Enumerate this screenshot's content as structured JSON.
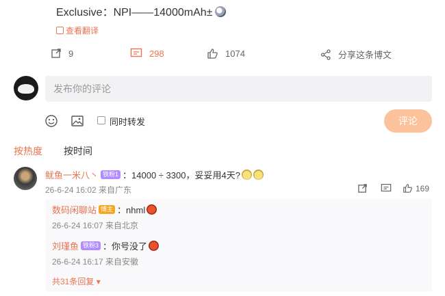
{
  "post": {
    "text": "Exclusive：NPI——14000mAh±",
    "translate_label": "查看翻译",
    "repost_count": "9",
    "comment_count": "298",
    "like_count": "1074",
    "share_label": "分享这条博文"
  },
  "composer": {
    "placeholder": "发布你的评论",
    "repost_label": "同时转发",
    "submit_label": "评论"
  },
  "sort": {
    "hot": "按热度",
    "time": "按时间"
  },
  "comment": {
    "user": "鱿鱼一米八丶",
    "badge": "铁粉1",
    "text": "：14000 ÷ 3300，妥妥用4天?",
    "meta": "26-6-24 16:02 来自广东",
    "likes": "169"
  },
  "replies": [
    {
      "user": "数码闲聊站",
      "badge": "博主",
      "text": "：nhml",
      "meta": "26-6-24 16:07 来自北京"
    },
    {
      "user": "刘瑾鱼",
      "badge": "铁粉3",
      "text": "：你号没了",
      "meta": "26-6-24 16:17 来自安徽"
    }
  ],
  "more_replies": "共31条回复",
  "colors": {
    "accent": "#eb7350",
    "submit_disabled": "#fbc29b"
  },
  "icons": [
    "repost-icon",
    "comment-icon",
    "like-icon",
    "share-icon",
    "emoji-icon",
    "image-icon",
    "reply-icon",
    "translate-icon"
  ]
}
